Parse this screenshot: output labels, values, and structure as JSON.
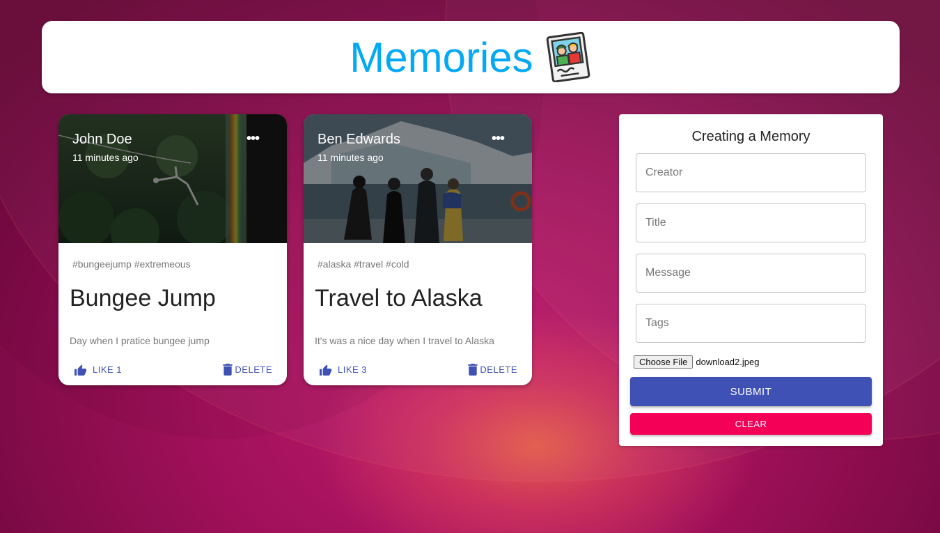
{
  "app": {
    "title": "Memories",
    "logo_icon": "memories-photo-icon",
    "accent_color": "#03a9f4"
  },
  "posts": [
    {
      "creator": "John Doe",
      "time": "11 minutes ago",
      "tags": "#bungeejump #extremeous",
      "title": "Bungee Jump",
      "message": "Day when I pratice bungee jump",
      "like_label": "LIKE 1",
      "delete_label": "DELETE",
      "image_subject": "bungee jumper over forest"
    },
    {
      "creator": "Ben Edwards",
      "time": "11 minutes ago",
      "tags": "#alaska #travel #cold",
      "title": "Travel to Alaska",
      "message": "It's was a nice day when I travel to Alaska",
      "like_label": "LIKE 3",
      "delete_label": "DELETE",
      "image_subject": "people watching glacier from boat"
    }
  ],
  "form": {
    "heading": "Creating a Memory",
    "creator_placeholder": "Creator",
    "title_placeholder": "Title",
    "message_placeholder": "Message",
    "tags_placeholder": "Tags",
    "file_button": "Choose File",
    "file_name": "download2.jpeg",
    "submit_label": "SUBMIT",
    "clear_label": "CLEAR",
    "submit_color": "#3f51b5",
    "clear_color": "#f50057"
  }
}
